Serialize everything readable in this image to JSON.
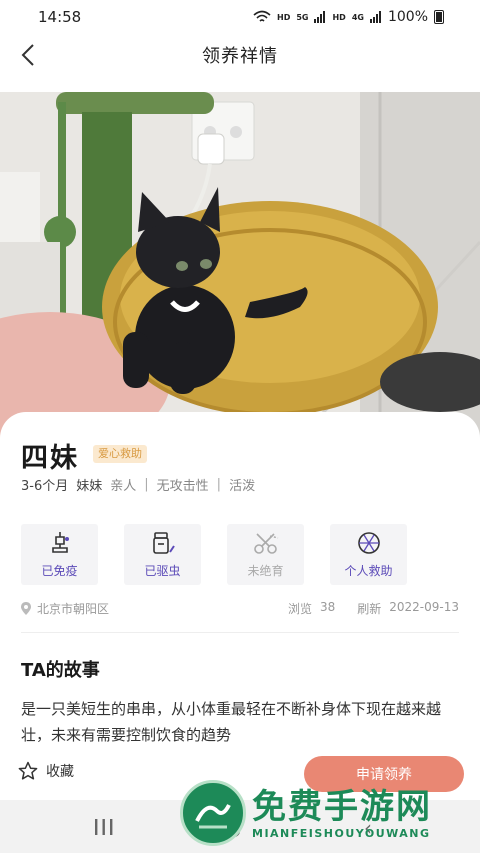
{
  "status": {
    "time": "14:58",
    "network_a": "HD",
    "network_b": "HD",
    "signal_a": "5G",
    "signal_b": "4G",
    "battery": "100%"
  },
  "nav": {
    "title": "领养祥情"
  },
  "pet": {
    "name": "四妹",
    "badge": "爱心救助",
    "age": "3-6个月",
    "gender": "妹妹",
    "traits": [
      "亲人",
      "无攻击性",
      "活泼"
    ]
  },
  "features": [
    {
      "label": "已免疫",
      "icon": "vaccine-icon",
      "active": true
    },
    {
      "label": "已驱虫",
      "icon": "deworm-icon",
      "active": true
    },
    {
      "label": "未绝育",
      "icon": "scissors-icon",
      "active": false
    },
    {
      "label": "个人救助",
      "icon": "rescue-icon",
      "active": true
    }
  ],
  "meta": {
    "location": "北京市朝阳区",
    "views_label": "浏览",
    "views": "38",
    "refresh_label": "刷新",
    "refresh_date": "2022-09-13"
  },
  "story": {
    "title": "TA的故事",
    "text": "是一只美短生的串串，从小体重最轻在不断补身体下现在越来越壮，未来有需要控制饮食的趋势"
  },
  "actions": {
    "favorite_label": "收藏",
    "apply_label": "申请领养"
  },
  "watermark": {
    "main": "免费手游网",
    "sub": "MIANFEISHOUYOUWANG"
  },
  "colors": {
    "accent": "#5c4bb8",
    "apply": "#e98773",
    "badge_bg": "#fbe9cf",
    "badge_text": "#d89a42"
  }
}
